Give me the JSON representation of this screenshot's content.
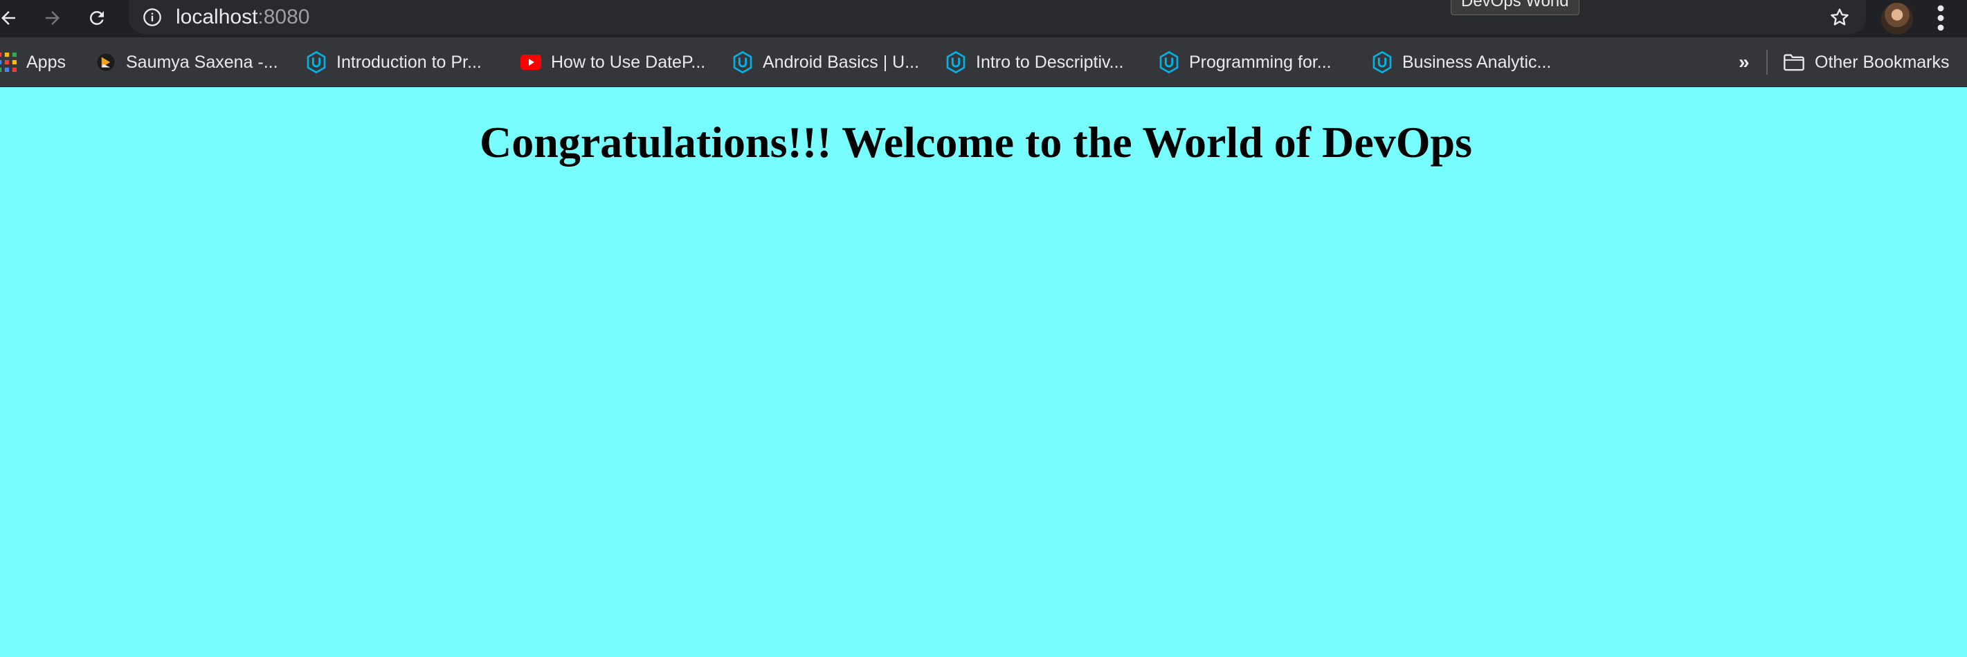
{
  "browser": {
    "address_bar": {
      "host": "localhost",
      "port": ":8080"
    },
    "tab_tooltip": "DevOps World"
  },
  "bookmarks": {
    "items": [
      {
        "label": "Apps",
        "icon": "apps-grid-icon"
      },
      {
        "label": "Saumya Saxena -...",
        "icon": "site-favicon-icon"
      },
      {
        "label": "Introduction to Pr...",
        "icon": "udacity-icon"
      },
      {
        "label": "How to Use DateP...",
        "icon": "youtube-icon"
      },
      {
        "label": "Android Basics | U...",
        "icon": "udacity-icon"
      },
      {
        "label": "Intro to Descriptiv...",
        "icon": "udacity-icon"
      },
      {
        "label": "Programming for...",
        "icon": "udacity-icon"
      },
      {
        "label": "Business Analytic...",
        "icon": "udacity-icon"
      }
    ],
    "overflow": "»",
    "other_bookmarks": "Other Bookmarks"
  },
  "page": {
    "heading": "Congratulations!!! Welcome to the World of DevOps",
    "background_color": "#78fdff"
  },
  "colors": {
    "toolbar": "#202124",
    "bookmarks_bar": "#35363a",
    "udacity": "#02b3e4",
    "youtube": "#ff0000"
  }
}
